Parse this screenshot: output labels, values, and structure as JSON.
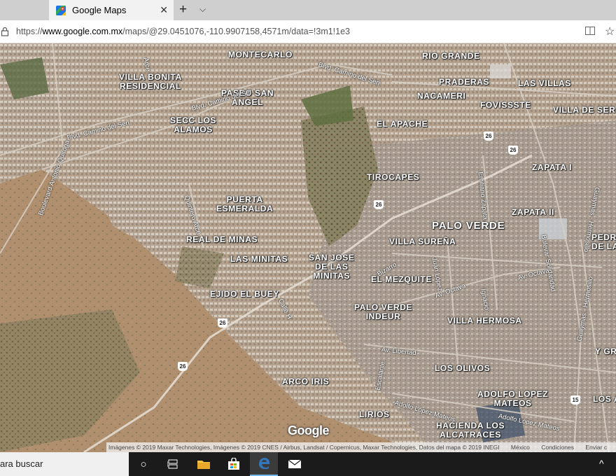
{
  "browser": {
    "tab_title": "Google Maps",
    "tab_close": "✕",
    "new_tab": "+",
    "tab_menu": "⌵",
    "url_prefix": "https://",
    "url_domain": "www.google.com.mx",
    "url_path": "/maps/@29.0451076,-110.9907158,4571m/data=!3m1!1e3",
    "reading_view": "📖",
    "favorite": "☆"
  },
  "map": {
    "labels": [
      {
        "id": "montecarlo",
        "text": "MONTECARLO"
      },
      {
        "id": "rio-grande",
        "text": "RIO GRANDE"
      },
      {
        "id": "villa-bonita",
        "text": "VILLA BONITA\nRESIDENCIAL"
      },
      {
        "id": "praderas",
        "text": "PRADERAS"
      },
      {
        "id": "las-villas",
        "text": "LAS VILLAS"
      },
      {
        "id": "paseo-san-angel",
        "text": "PASEO SAN\nANGEL"
      },
      {
        "id": "nacameri",
        "text": "NACAMERI"
      },
      {
        "id": "fovisssste",
        "text": "FOVISSSTE"
      },
      {
        "id": "villa-de-ser",
        "text": "VILLA DE SER"
      },
      {
        "id": "secc-los-alamos",
        "text": "SECC LOS\nALAMOS"
      },
      {
        "id": "el-apache",
        "text": "EL APACHE"
      },
      {
        "id": "tirocapes",
        "text": "TIROCAPES"
      },
      {
        "id": "zapata-i",
        "text": "ZAPATA I"
      },
      {
        "id": "puerta-esmeralda",
        "text": "PUERTA\nESMERALDA"
      },
      {
        "id": "zapata-ii",
        "text": "ZAPATA II"
      },
      {
        "id": "palo-verde",
        "text": "PALO VERDE"
      },
      {
        "id": "pedro-de-la",
        "text": "PEDR\nDE LA"
      },
      {
        "id": "real-de-minas",
        "text": "REAL DE MINAS"
      },
      {
        "id": "villa-surena",
        "text": "VILLA SUREÑA"
      },
      {
        "id": "las-minitas",
        "text": "LAS MINITAS"
      },
      {
        "id": "san-jose-minitas",
        "text": "SAN JOSE\nDE LAS\nMINITAS"
      },
      {
        "id": "el-mezquite",
        "text": "EL MEZQUITE"
      },
      {
        "id": "ejido-el-buey",
        "text": "EJIDO EL BUEY"
      },
      {
        "id": "palo-verde-indeur",
        "text": "PALO VERDE\nINDEUR"
      },
      {
        "id": "villa-hermosa",
        "text": "VILLA HERMOSA"
      },
      {
        "id": "y-gr",
        "text": "Y GR"
      },
      {
        "id": "los-olivos",
        "text": "LOS OLIVOS"
      },
      {
        "id": "arco-iris",
        "text": "ARCO IRIS"
      },
      {
        "id": "adolfo-lopez-mateos",
        "text": "ADOLFO LOPEZ\nMATEOS"
      },
      {
        "id": "los-a",
        "text": "LOS A"
      },
      {
        "id": "lirios",
        "text": "LIRIOS"
      },
      {
        "id": "hacienda-los-alcatraces",
        "text": "HACIENDA LOS\nALCATRACES"
      }
    ],
    "roads": [
      {
        "id": "blvd-camino-del-seri-1",
        "text": "Blvd. Camino del Seri"
      },
      {
        "id": "blvd-camino-del-seri-2",
        "text": "Blvd. Camino del Seri"
      },
      {
        "id": "blvd-camino-del-seri-3",
        "text": "Blvd. Camino del Seri"
      },
      {
        "id": "boulevard-antonio-quiroga",
        "text": "Boulevard Antonio Quiroga"
      },
      {
        "id": "quintero-arce",
        "text": "Quintero Arce"
      },
      {
        "id": "emiliano-zapata",
        "text": "Emiliano Zapata"
      },
      {
        "id": "bulevar-solidaridad",
        "text": "Bulevar Solidaridad"
      },
      {
        "id": "guaymas-hermosillo-1",
        "text": "Guaymas - Hermosillo"
      },
      {
        "id": "guaymas-hermosillo-2",
        "text": "Guaymas - Hermosillo"
      },
      {
        "id": "av-octava-1",
        "text": "Av. Octava"
      },
      {
        "id": "av-octava-2",
        "text": "Av. Octava"
      },
      {
        "id": "calle-h",
        "text": "Calle H"
      },
      {
        "id": "bizarro",
        "text": "Bizarro"
      },
      {
        "id": "av-libertad",
        "text": "Av. Libertad"
      },
      {
        "id": "escalante",
        "text": "Escalante"
      },
      {
        "id": "adolfo-lopez-mateos-road",
        "text": "Adolfo López Mateos"
      },
      {
        "id": "adolfo-lopez-mateos-road-2",
        "text": "Adolfo López Mateos"
      },
      {
        "id": "juan-lopez",
        "text": "Juan López"
      },
      {
        "id": "ignacio",
        "text": "Ignacio"
      },
      {
        "id": "arce",
        "text": "Arce"
      }
    ],
    "shields": [
      "26",
      "26",
      "26",
      "26",
      "26",
      "15"
    ],
    "google_logo": "Google",
    "attribution": "Imágenes © 2019 Maxar Technologies, Imágenes © 2019 CNES / Airbus, Landsat / Copernicus, Maxar Technologies, Datos del mapa © 2019 INEGI",
    "country": "México",
    "terms": "Condiciones",
    "feedback": "Enviar c"
  },
  "taskbar": {
    "search_placeholder": "ara buscar",
    "task_view": "○",
    "tray_chevron": "^"
  }
}
